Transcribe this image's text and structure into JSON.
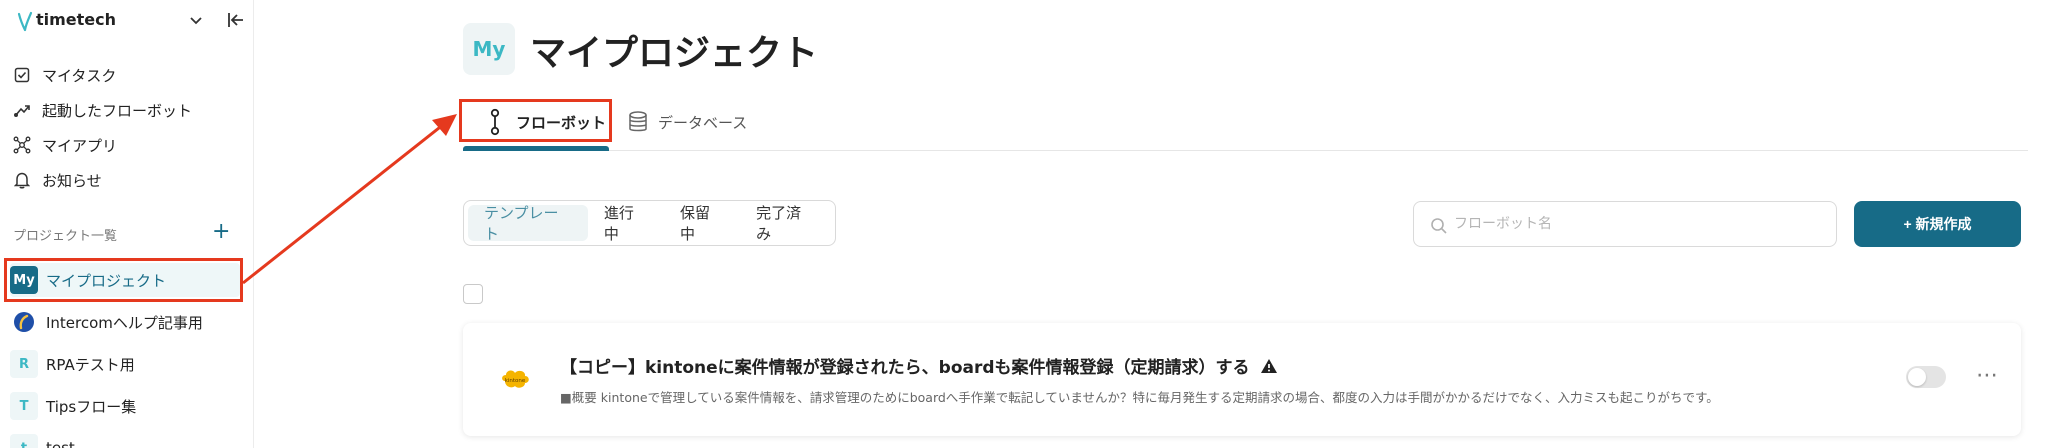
{
  "workspace": {
    "name": "timetech"
  },
  "nav": {
    "items": [
      {
        "label": "マイタスク",
        "icon": "checkbox-icon"
      },
      {
        "label": "起動したフローボット",
        "icon": "flow-trend-icon"
      },
      {
        "label": "マイアプリ",
        "icon": "apps-network-icon"
      },
      {
        "label": "お知らせ",
        "icon": "bell-icon"
      }
    ]
  },
  "projects": {
    "section_label": "プロジェクト一覧",
    "items": [
      {
        "badge": "My",
        "label": "マイプロジェクト",
        "badge_bg": "#176b87",
        "badge_fg": "#ffffff"
      },
      {
        "badge": "",
        "label": "Intercomヘルプ記事用",
        "badge_bg": "#ffffff",
        "badge_fg": "#1f4fa8"
      },
      {
        "badge": "R",
        "label": "RPAテスト用",
        "badge_bg": "#eef6f7",
        "badge_fg": "#3cb8c4"
      },
      {
        "badge": "T",
        "label": "Tipsフロー集",
        "badge_bg": "#eef6f7",
        "badge_fg": "#3cb8c4"
      },
      {
        "badge": "t",
        "label": "test",
        "badge_bg": "#eef6f7",
        "badge_fg": "#3cb8c4"
      }
    ]
  },
  "page": {
    "badge": "My",
    "title": "マイプロジェクト"
  },
  "tabs": [
    {
      "label": "フローボット",
      "icon": "flowbot-icon",
      "active": true
    },
    {
      "label": "データベース",
      "icon": "database-icon",
      "active": false
    }
  ],
  "filters": [
    {
      "label": "テンプレート",
      "active": true
    },
    {
      "label": "進行中",
      "active": false
    },
    {
      "label": "保留中",
      "active": false
    },
    {
      "label": "完了済み",
      "active": false
    }
  ],
  "search": {
    "placeholder": "フローボット名"
  },
  "new_button": {
    "label": "+ 新規作成"
  },
  "flows": [
    {
      "title": "【コピー】kintoneに案件情報が登録されたら、boardも案件情報登録（定期請求）する",
      "description": "■概要 kintoneで管理している案件情報を、請求管理のためにboardへ手作業で転記していませんか？特に毎月発生する定期請求の場合、都度の入力は手間がかかるだけでなく、入力ミスも起こりがちです。このワークフ...",
      "logo_text": "kintone",
      "enabled": false
    }
  ],
  "colors": {
    "accent": "#176b87",
    "annotation": "#e5391e"
  }
}
